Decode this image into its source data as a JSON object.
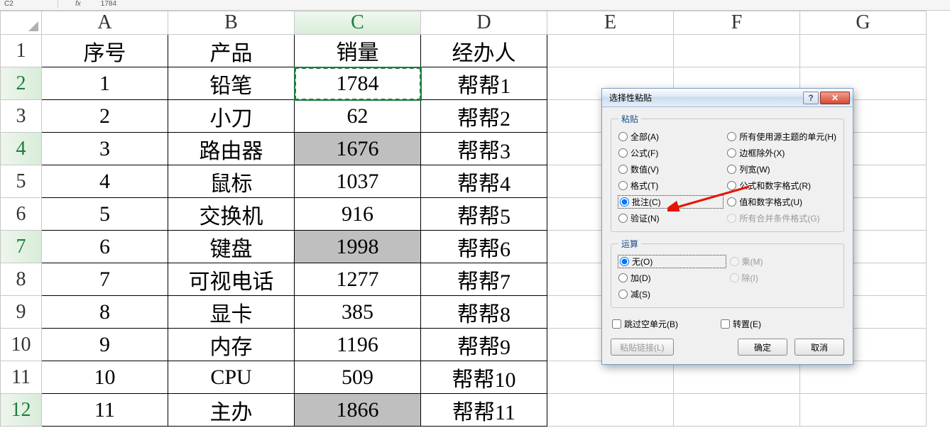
{
  "formula_bar": {
    "namebox": "C2",
    "fx": "fx",
    "value": "1784"
  },
  "columns": [
    "A",
    "B",
    "C",
    "D",
    "E",
    "F",
    "G"
  ],
  "active_column": "C",
  "row_numbers": [
    1,
    2,
    3,
    4,
    5,
    6,
    7,
    8,
    9,
    10,
    11,
    12
  ],
  "green_rows": [
    2,
    4,
    7,
    12
  ],
  "header_row": {
    "a": "序号",
    "b": "产品",
    "c": "销量",
    "d": "经办人"
  },
  "rows": [
    {
      "a": "1",
      "b": "铅笔",
      "c": "1784",
      "d": "帮帮1",
      "hl": false,
      "active": true
    },
    {
      "a": "2",
      "b": "小刀",
      "c": "62",
      "d": "帮帮2",
      "hl": false
    },
    {
      "a": "3",
      "b": "路由器",
      "c": "1676",
      "d": "帮帮3",
      "hl": true
    },
    {
      "a": "4",
      "b": "鼠标",
      "c": "1037",
      "d": "帮帮4",
      "hl": false
    },
    {
      "a": "5",
      "b": "交换机",
      "c": "916",
      "d": "帮帮5",
      "hl": false
    },
    {
      "a": "6",
      "b": "键盘",
      "c": "1998",
      "d": "帮帮6",
      "hl": true
    },
    {
      "a": "7",
      "b": "可视电话",
      "c": "1277",
      "d": "帮帮7",
      "hl": false
    },
    {
      "a": "8",
      "b": "显卡",
      "c": "385",
      "d": "帮帮8",
      "hl": false
    },
    {
      "a": "9",
      "b": "内存",
      "c": "1196",
      "d": "帮帮9",
      "hl": false
    },
    {
      "a": "10",
      "b": "CPU",
      "c": "509",
      "d": "帮帮10",
      "hl": false
    },
    {
      "a": "11",
      "b": "主办",
      "c": "1866",
      "d": "帮帮11",
      "hl": true
    }
  ],
  "dialog": {
    "title": "选择性粘贴",
    "help_icon": "?",
    "close_icon": "✕",
    "fs_paste": "粘贴",
    "paste_options_left": [
      {
        "label": "全部(A)"
      },
      {
        "label": "公式(F)"
      },
      {
        "label": "数值(V)"
      },
      {
        "label": "格式(T)"
      },
      {
        "label": "批注(C)",
        "selected": true
      },
      {
        "label": "验证(N)"
      }
    ],
    "paste_options_right": [
      {
        "label": "所有使用源主题的单元(H)"
      },
      {
        "label": "边框除外(X)"
      },
      {
        "label": "列宽(W)"
      },
      {
        "label": "公式和数字格式(R)"
      },
      {
        "label": "值和数字格式(U)"
      },
      {
        "label": "所有合并条件格式(G)",
        "disabled": true
      }
    ],
    "fs_op": "运算",
    "op_left": [
      {
        "label": "无(O)",
        "selected": true
      },
      {
        "label": "加(D)"
      },
      {
        "label": "减(S)"
      }
    ],
    "op_right": [
      {
        "label": "乘(M)",
        "disabled": true
      },
      {
        "label": "除(I)",
        "disabled": true
      }
    ],
    "chk_skip": "跳过空单元(B)",
    "chk_transpose": "转置(E)",
    "btn_pastelink": "粘贴链接(L)",
    "btn_ok": "确定",
    "btn_cancel": "取消"
  }
}
